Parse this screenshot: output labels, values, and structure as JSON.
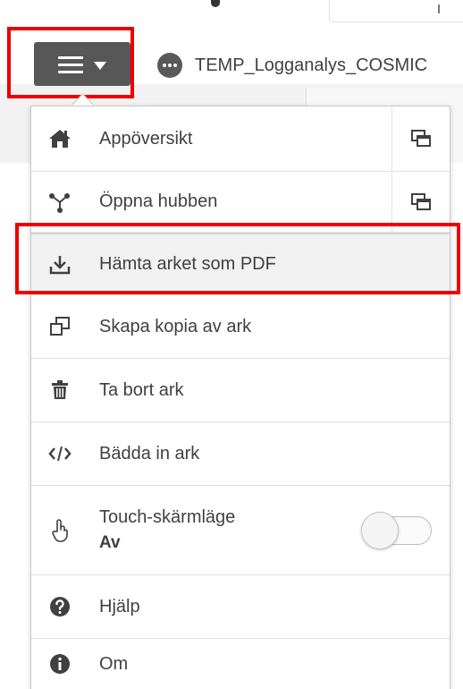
{
  "header": {
    "app_title": "TEMP_Logganalys_COSMIC",
    "menu_button": {
      "icon": "hamburger-icon",
      "caret": "caret-down-icon"
    }
  },
  "menu": {
    "items": [
      {
        "label": "Appöversikt",
        "icon": "home-icon",
        "ext_icon": "open-new-window-icon"
      },
      {
        "label": "Öppna hubben",
        "icon": "hub-icon",
        "ext_icon": "open-new-window-icon"
      },
      {
        "label": "Hämta arket som PDF",
        "icon": "download-icon",
        "highlighted": true
      },
      {
        "label": "Skapa kopia av ark",
        "icon": "duplicate-icon"
      },
      {
        "label": "Ta bort ark",
        "icon": "trash-icon"
      },
      {
        "label": "Bädda in ark",
        "icon": "code-icon"
      },
      {
        "label": "Touch-skärmläge",
        "sublabel": "Av",
        "icon": "touch-icon",
        "toggle_on": false
      },
      {
        "label": "Hjälp",
        "icon": "help-icon"
      },
      {
        "label": "Om",
        "icon": "info-icon"
      }
    ]
  },
  "colors": {
    "menu_button_bg": "#575757",
    "annotation_red": "#ee0000",
    "text": "#404040",
    "highlight_bg": "#f1f1f1"
  }
}
